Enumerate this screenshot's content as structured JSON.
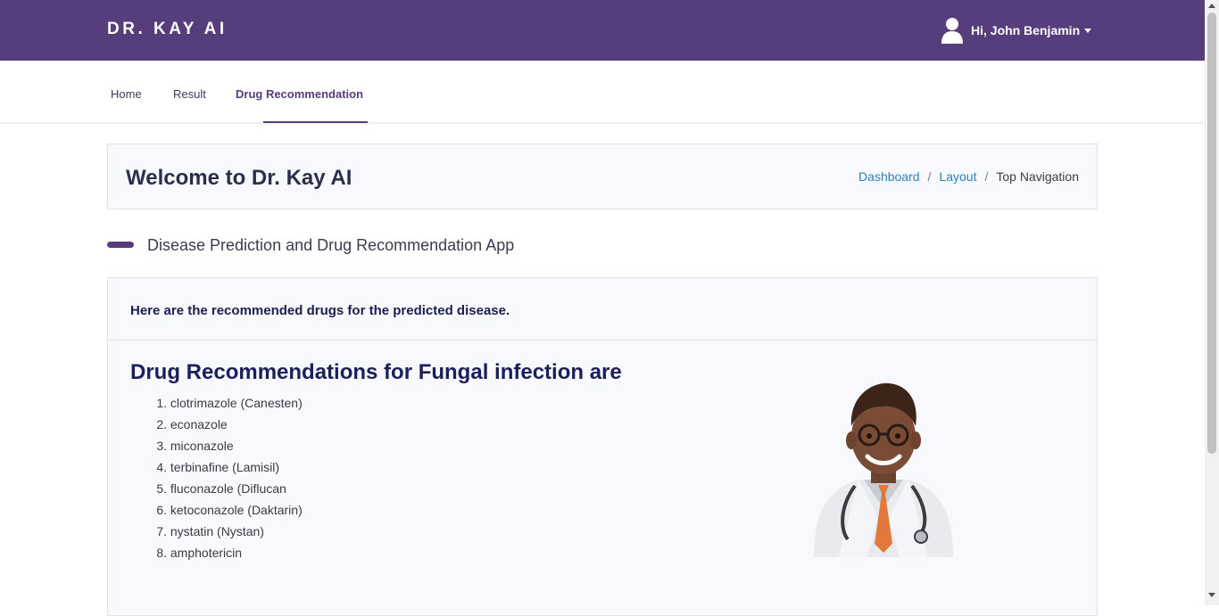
{
  "brand": "DR. KAY AI",
  "user": {
    "greeting": "Hi, John Benjamin"
  },
  "nav": {
    "items": [
      {
        "label": "Home",
        "active": false
      },
      {
        "label": "Result",
        "active": false
      },
      {
        "label": "Drug Recommendation",
        "active": true
      }
    ]
  },
  "page": {
    "title": "Welcome to Dr. Kay AI",
    "breadcrumb": [
      "Dashboard",
      "Layout",
      "Top Navigation"
    ]
  },
  "section": {
    "label": "Disease Prediction and Drug Recommendation App"
  },
  "result": {
    "header": "Here are the recommended drugs for the predicted disease.",
    "title": "Drug Recommendations for Fungal infection are",
    "drugs": [
      "clotrimazole (Canesten)",
      "econazole",
      "miconazole",
      "terbinafine (Lamisil)",
      "fluconazole (Diflucan",
      "ketoconazole (Daktarin)",
      "nystatin (Nystan)",
      "amphotericin"
    ]
  },
  "colors": {
    "brand": "#563d7c",
    "link": "#2c7fc1"
  },
  "icons": {
    "user": "user-icon",
    "caret": "caret-down-icon",
    "doctor": "doctor-illustration"
  }
}
